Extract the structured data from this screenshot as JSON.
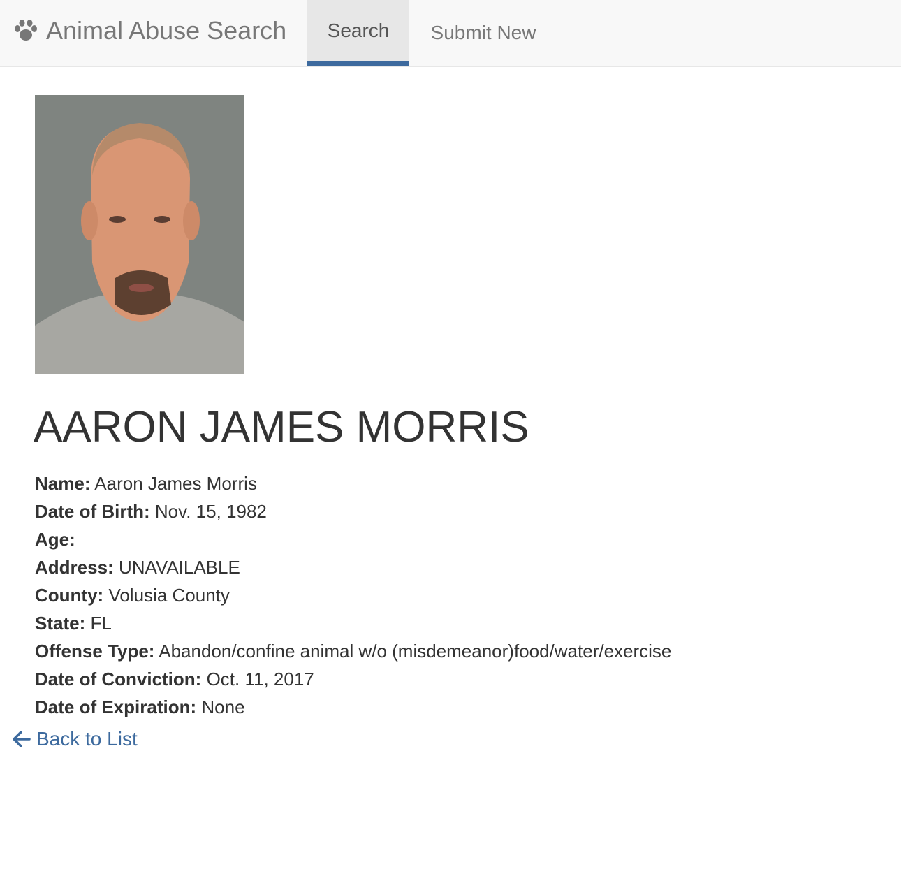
{
  "navbar": {
    "brand_icon": "paw-icon",
    "brand_label": "Animal Abuse Search",
    "tabs": [
      {
        "label": "Search",
        "active": true
      },
      {
        "label": "Submit New",
        "active": false
      }
    ]
  },
  "profile": {
    "title": "AARON JAMES MORRIS",
    "fields": [
      {
        "label": "Name:",
        "value": "Aaron James Morris"
      },
      {
        "label": "Date of Birth:",
        "value": "Nov. 15, 1982"
      },
      {
        "label": "Age:",
        "value": ""
      },
      {
        "label": "Address:",
        "value": "UNAVAILABLE"
      },
      {
        "label": "County:",
        "value": "Volusia County"
      },
      {
        "label": "State:",
        "value": "FL"
      },
      {
        "label": "Offense Type:",
        "value": "Abandon/confine animal w/o (misdemeanor)food/water/exercise"
      },
      {
        "label": "Date of Conviction:",
        "value": "Oct. 11, 2017"
      },
      {
        "label": "Date of Expiration:",
        "value": "None"
      }
    ]
  },
  "back_link": {
    "icon": "arrow-left-icon",
    "label": "Back to List"
  },
  "colors": {
    "link": "#3d6a9e",
    "navbar_bg": "#f8f8f8",
    "active_tab_bg": "#e7e7e7"
  }
}
